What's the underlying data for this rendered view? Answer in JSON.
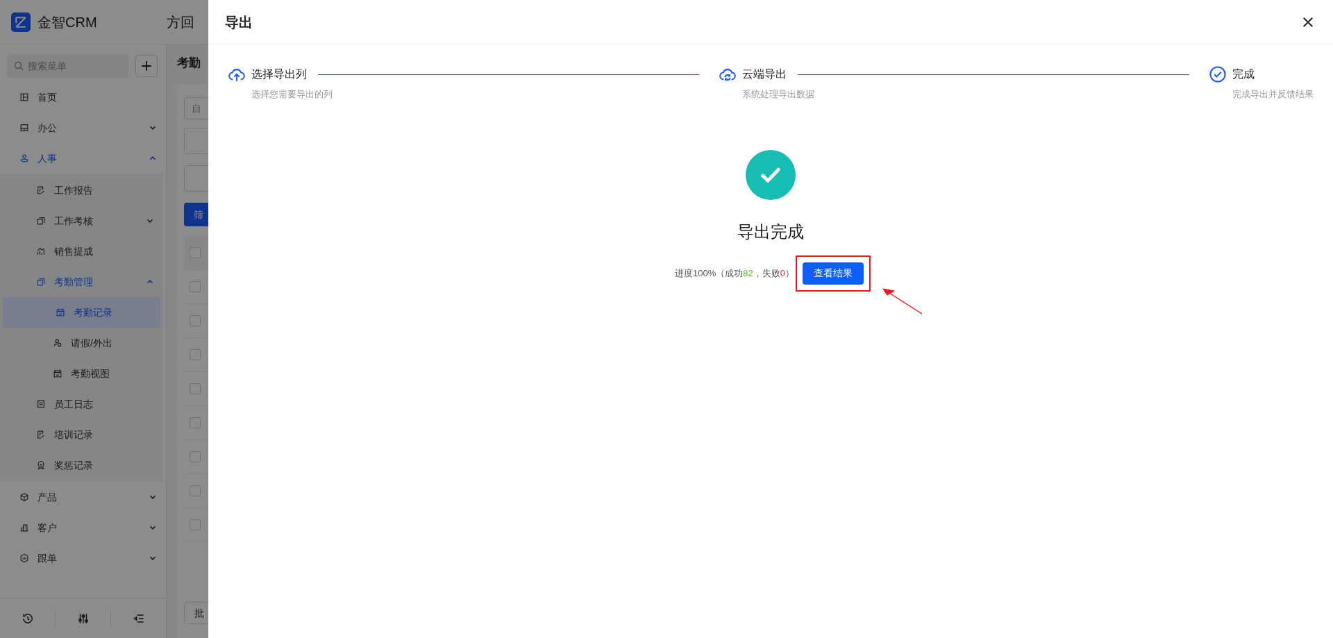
{
  "app": {
    "logo_text": "金智CRM",
    "header_title": "方回"
  },
  "sidebar": {
    "search_placeholder": "搜索菜单",
    "items": [
      {
        "label": "首页",
        "kind": "grid",
        "selected": false
      },
      {
        "label": "办公",
        "kind": "inbox",
        "selected": false,
        "expanded": false
      },
      {
        "label": "人事",
        "kind": "person",
        "selected": false,
        "expanded": true,
        "children": [
          {
            "label": "工作报告",
            "kind": "doc",
            "selected": false
          },
          {
            "label": "工作考核",
            "kind": "stack",
            "selected": false,
            "expanded": false
          },
          {
            "label": "销售提成",
            "kind": "chart",
            "selected": false
          },
          {
            "label": "考勤管理",
            "kind": "stack",
            "selected": false,
            "expanded": true,
            "children": [
              {
                "label": "考勤记录",
                "kind": "calendar",
                "selected": true
              },
              {
                "label": "请假/外出",
                "kind": "people",
                "selected": false
              },
              {
                "label": "考勤视图",
                "kind": "calendar",
                "selected": false
              }
            ]
          },
          {
            "label": "员工日志",
            "kind": "notebook",
            "selected": false
          },
          {
            "label": "培训记录",
            "kind": "doc",
            "selected": false
          },
          {
            "label": "奖惩记录",
            "kind": "medal",
            "selected": false
          }
        ]
      },
      {
        "label": "产品",
        "kind": "box",
        "selected": false,
        "expanded": false
      },
      {
        "label": "客户",
        "kind": "building",
        "selected": false,
        "expanded": false
      },
      {
        "label": "跟单",
        "kind": "hexagon",
        "selected": false,
        "expanded": false
      }
    ]
  },
  "page": {
    "title": "考勤",
    "filter_placeholder": "自",
    "filter_button": "筛",
    "batch_button": "批",
    "rows": [
      {
        "checked": false
      },
      {
        "checked": false
      },
      {
        "checked": false
      },
      {
        "checked": false
      },
      {
        "checked": false
      },
      {
        "checked": false
      },
      {
        "checked": false
      },
      {
        "checked": false
      },
      {
        "checked": false
      }
    ]
  },
  "drawer": {
    "title": "导出",
    "steps": [
      {
        "kind": "upload",
        "title": "选择导出列",
        "description": "选择您需要导出的列",
        "done": true
      },
      {
        "kind": "sync",
        "title": "云端导出",
        "description": "系统处理导出数据",
        "done": true
      },
      {
        "kind": "check",
        "title": "完成",
        "description": "完成导出并反馈结果",
        "done": true
      }
    ],
    "result": {
      "title": "导出完成",
      "progress_prefix": "进度100%（成功",
      "success_count": "82",
      "separator": "，失败",
      "fail_count": "0",
      "closing": "）",
      "button": "查看结果"
    }
  }
}
